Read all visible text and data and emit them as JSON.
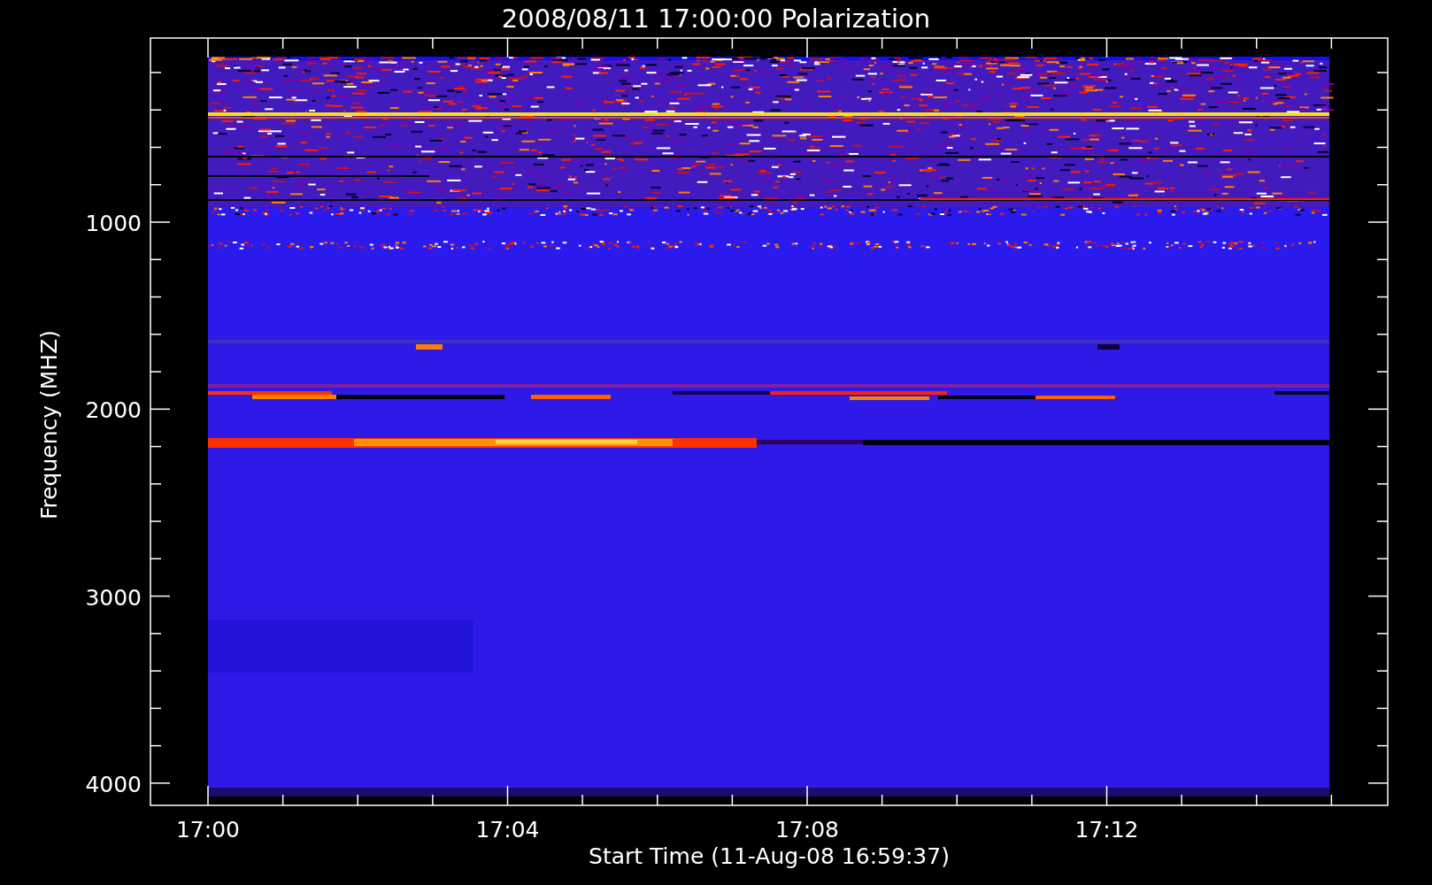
{
  "title": "2008/08/11 17:00:00 Polarization",
  "y_axis": {
    "label": "Frequency (MHZ)",
    "ticks": [
      "1000",
      "2000",
      "3000",
      "4000"
    ]
  },
  "x_axis": {
    "label": "Start Time (11-Aug-08 16:59:37)",
    "ticks": [
      "17:00",
      "17:04",
      "17:08",
      "17:12"
    ]
  }
}
